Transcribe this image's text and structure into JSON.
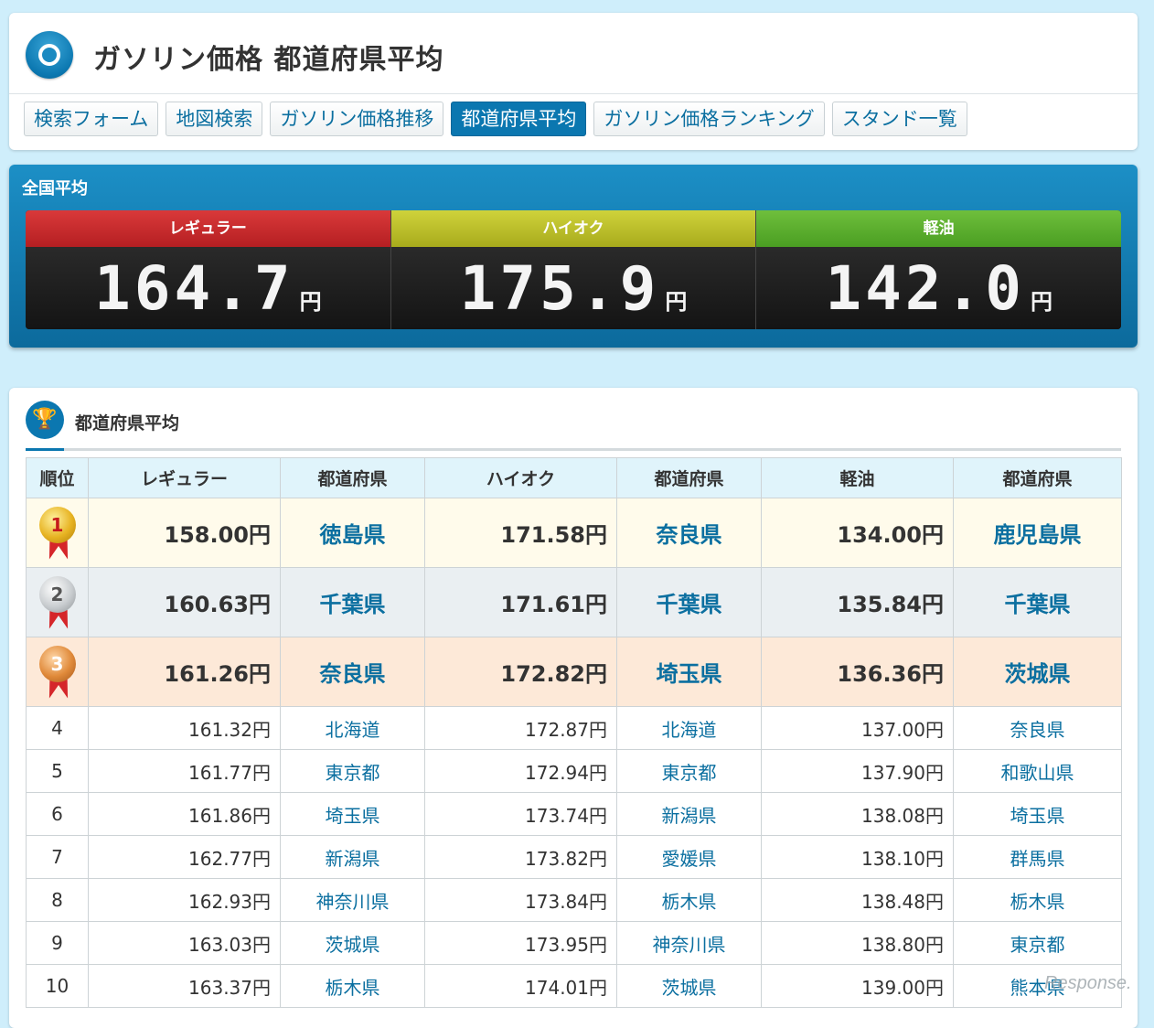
{
  "header": {
    "title": "ガソリン価格 都道府県平均",
    "tabs": [
      {
        "label": "検索フォーム",
        "active": false
      },
      {
        "label": "地図検索",
        "active": false
      },
      {
        "label": "ガソリン価格推移",
        "active": false
      },
      {
        "label": "都道府県平均",
        "active": true
      },
      {
        "label": "ガソリン価格ランキング",
        "active": false
      },
      {
        "label": "スタンド一覧",
        "active": false
      }
    ]
  },
  "national": {
    "title": "全国平均",
    "unit": "円",
    "regular": {
      "label": "レギュラー",
      "value": "164.7"
    },
    "high": {
      "label": "ハイオク",
      "value": "175.9"
    },
    "diesel": {
      "label": "軽油",
      "value": "142.0"
    }
  },
  "ranking": {
    "title": "都道府県平均",
    "columns": [
      "順位",
      "レギュラー",
      "都道府県",
      "ハイオク",
      "都道府県",
      "軽油",
      "都道府県"
    ],
    "rows": [
      {
        "rank": "1",
        "regular": "158.00円",
        "regular_pref": "徳島県",
        "high": "171.58円",
        "high_pref": "奈良県",
        "diesel": "134.00円",
        "diesel_pref": "鹿児島県"
      },
      {
        "rank": "2",
        "regular": "160.63円",
        "regular_pref": "千葉県",
        "high": "171.61円",
        "high_pref": "千葉県",
        "diesel": "135.84円",
        "diesel_pref": "千葉県"
      },
      {
        "rank": "3",
        "regular": "161.26円",
        "regular_pref": "奈良県",
        "high": "172.82円",
        "high_pref": "埼玉県",
        "diesel": "136.36円",
        "diesel_pref": "茨城県"
      },
      {
        "rank": "4",
        "regular": "161.32円",
        "regular_pref": "北海道",
        "high": "172.87円",
        "high_pref": "北海道",
        "diesel": "137.00円",
        "diesel_pref": "奈良県"
      },
      {
        "rank": "5",
        "regular": "161.77円",
        "regular_pref": "東京都",
        "high": "172.94円",
        "high_pref": "東京都",
        "diesel": "137.90円",
        "diesel_pref": "和歌山県"
      },
      {
        "rank": "6",
        "regular": "161.86円",
        "regular_pref": "埼玉県",
        "high": "173.74円",
        "high_pref": "新潟県",
        "diesel": "138.08円",
        "diesel_pref": "埼玉県"
      },
      {
        "rank": "7",
        "regular": "162.77円",
        "regular_pref": "新潟県",
        "high": "173.82円",
        "high_pref": "愛媛県",
        "diesel": "138.10円",
        "diesel_pref": "群馬県"
      },
      {
        "rank": "8",
        "regular": "162.93円",
        "regular_pref": "神奈川県",
        "high": "173.84円",
        "high_pref": "栃木県",
        "diesel": "138.48円",
        "diesel_pref": "栃木県"
      },
      {
        "rank": "9",
        "regular": "163.03円",
        "regular_pref": "茨城県",
        "high": "173.95円",
        "high_pref": "神奈川県",
        "diesel": "138.80円",
        "diesel_pref": "東京都"
      },
      {
        "rank": "10",
        "regular": "163.37円",
        "regular_pref": "栃木県",
        "high": "174.01円",
        "high_pref": "茨城県",
        "diesel": "139.00円",
        "diesel_pref": "熊本県"
      }
    ]
  },
  "watermark": "Response.",
  "colors": {
    "accent": "#0b77b0",
    "background": "#cfeefb",
    "regular": "#c62a2c",
    "high": "#bcc02a",
    "diesel": "#5aae2e"
  },
  "icons": {
    "title": "ring-icon",
    "ranking": "trophy-icon"
  }
}
